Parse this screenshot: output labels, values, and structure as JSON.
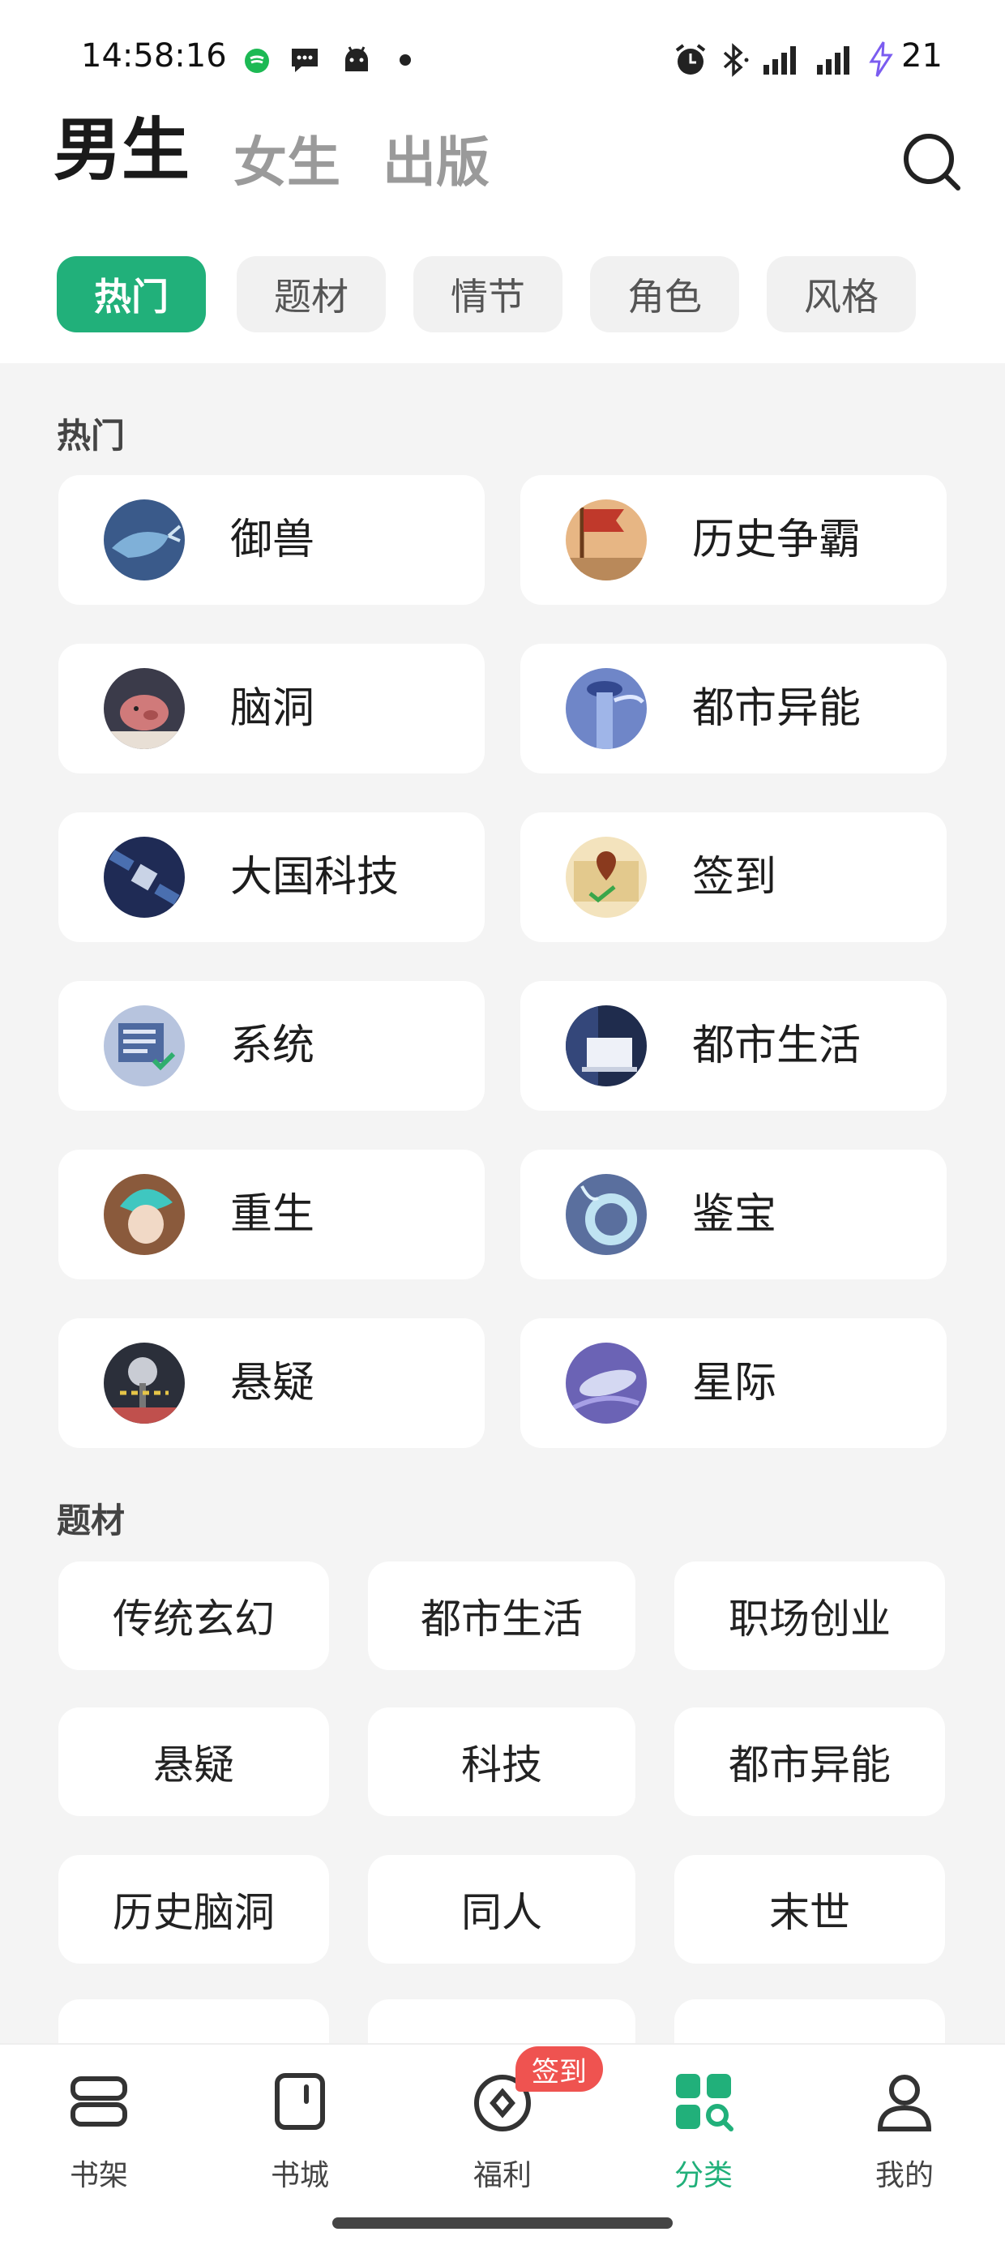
{
  "status_bar": {
    "time": "14:58:16",
    "battery": "21"
  },
  "gender_tabs": [
    {
      "label": "男生",
      "active": true
    },
    {
      "label": "女生",
      "active": false
    },
    {
      "label": "出版",
      "active": false
    }
  ],
  "filter_chips": [
    {
      "label": "热门",
      "active": true
    },
    {
      "label": "题材",
      "active": false
    },
    {
      "label": "情节",
      "active": false
    },
    {
      "label": "角色",
      "active": false
    },
    {
      "label": "风格",
      "active": false
    }
  ],
  "hot": {
    "title": "热门",
    "items": [
      {
        "label": "御兽",
        "icon": "whale-icon"
      },
      {
        "label": "历史争霸",
        "icon": "war-flag-icon"
      },
      {
        "label": "脑洞",
        "icon": "pig-icon"
      },
      {
        "label": "都市异能",
        "icon": "tower-icon"
      },
      {
        "label": "大国科技",
        "icon": "satellite-icon"
      },
      {
        "label": "签到",
        "icon": "map-pin-icon"
      },
      {
        "label": "系统",
        "icon": "screen-check-icon"
      },
      {
        "label": "都市生活",
        "icon": "laptop-icon"
      },
      {
        "label": "重生",
        "icon": "figure-icon"
      },
      {
        "label": "鉴宝",
        "icon": "jade-ring-icon"
      },
      {
        "label": "悬疑",
        "icon": "lamp-icon"
      },
      {
        "label": "星际",
        "icon": "spaceship-icon"
      }
    ]
  },
  "topics": {
    "title": "题材",
    "items": [
      "传统玄幻",
      "都市生活",
      "职场创业",
      "悬疑",
      "科技",
      "都市异能",
      "历史脑洞",
      "同人",
      "末世"
    ]
  },
  "bottom_nav": [
    {
      "label": "书架",
      "icon": "bookshelf-icon",
      "active": false
    },
    {
      "label": "书城",
      "icon": "bookstore-icon",
      "active": false
    },
    {
      "label": "福利",
      "icon": "coin-icon",
      "active": false
    },
    {
      "label": "分类",
      "icon": "category-icon",
      "active": true
    },
    {
      "label": "我的",
      "icon": "profile-icon",
      "active": false
    }
  ],
  "signin_badge": "签到",
  "colors": {
    "accent": "#21b07a",
    "badge": "#ef5350",
    "background": "#f4f4f4"
  }
}
